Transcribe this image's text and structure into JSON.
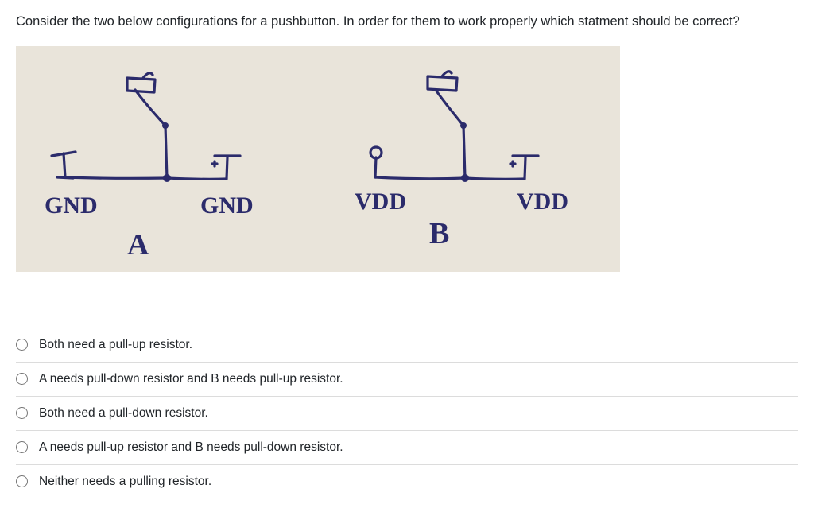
{
  "question": "Consider the two below configurations for a pushbutton. In order for them to work properly which statment should be correct?",
  "diagram": {
    "A": {
      "left_label": "GND",
      "right_label": "GND",
      "tag": "A"
    },
    "B": {
      "left_label": "VDD",
      "right_label": "VDD",
      "tag": "B"
    }
  },
  "options": [
    {
      "label": "Both need a pull-up resistor."
    },
    {
      "label": "A needs pull-down resistor and B needs pull-up resistor."
    },
    {
      "label": "Both need a pull-down resistor."
    },
    {
      "label": "A needs pull-up resistor and B needs pull-down resistor."
    },
    {
      "label": "Neither needs a pulling resistor."
    }
  ]
}
